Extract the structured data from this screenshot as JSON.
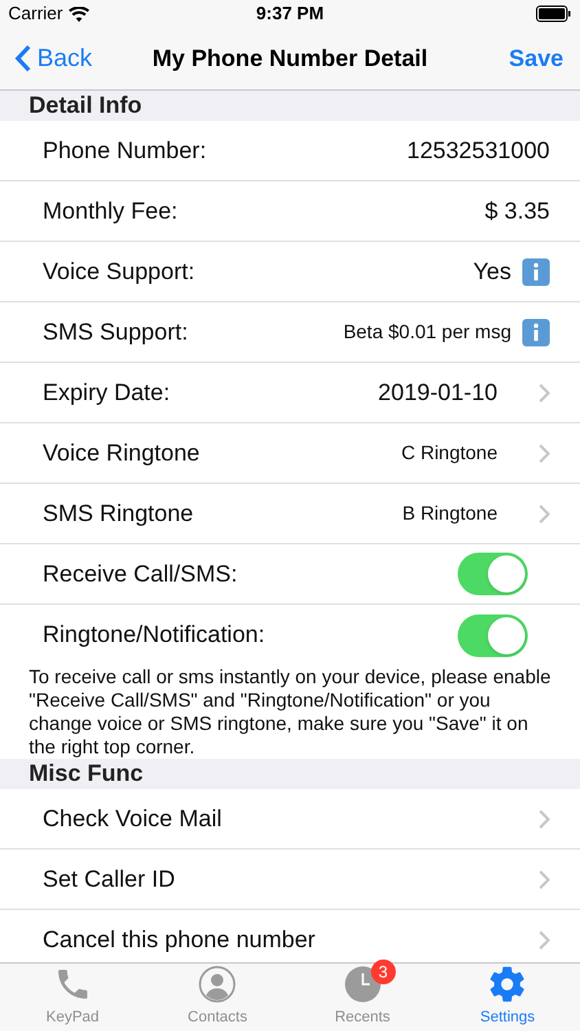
{
  "status_bar": {
    "carrier": "Carrier",
    "time": "9:37 PM"
  },
  "nav": {
    "back": "Back",
    "title": "My Phone Number Detail",
    "action": "Save"
  },
  "sections": [
    {
      "title": "Detail Info",
      "rows": [
        {
          "kind": "value",
          "label": "Phone Number:",
          "value": "12532531000"
        },
        {
          "kind": "value",
          "label": "Monthly Fee:",
          "value": "$ 3.35"
        },
        {
          "kind": "info",
          "label": "Voice Support:",
          "value": "Yes"
        },
        {
          "kind": "info",
          "label": "SMS Support:",
          "value": "Beta $0.01 per msg",
          "small": true
        },
        {
          "kind": "chevron",
          "label": "Expiry Date:",
          "value": "2019-01-10"
        },
        {
          "kind": "chevron",
          "label": "Voice Ringtone",
          "value": "C Ringtone",
          "small": true
        },
        {
          "kind": "chevron",
          "label": "SMS Ringtone",
          "value": "B Ringtone",
          "small": true
        },
        {
          "kind": "toggle",
          "label": "Receive Call/SMS:",
          "on": true
        },
        {
          "kind": "toggle",
          "label": "Ringtone/Notification:",
          "on": true
        }
      ],
      "note": "To receive call or sms instantly on your device, please enable \"Receive Call/SMS\" and \"Ringtone/Notification\" or you change voice or SMS ringtone,  make sure you \"Save\" it on the right top corner."
    },
    {
      "title": "Misc Func",
      "rows": [
        {
          "kind": "chevron",
          "label": "Check Voice Mail"
        },
        {
          "kind": "chevron",
          "label": "Set Caller ID"
        },
        {
          "kind": "chevron",
          "label": "Cancel this phone number"
        }
      ]
    }
  ],
  "tabs": [
    {
      "label": "KeyPad",
      "selected": false
    },
    {
      "label": "Contacts",
      "selected": false
    },
    {
      "label": "Recents",
      "selected": false,
      "badge": "3"
    },
    {
      "label": "Settings",
      "selected": true
    }
  ]
}
